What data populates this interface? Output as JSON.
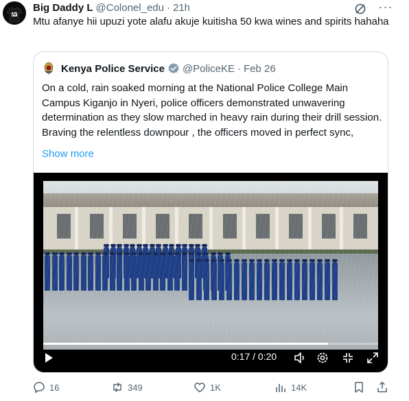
{
  "tweet": {
    "author_name": "Big Daddy L",
    "handle": "@Colonel_edu",
    "separator": "·",
    "time": "21h",
    "text": "Mtu afanye hii upuzi yote alafu akuje kuitisha 50 kwa wines and spirits hahaha",
    "more_icon": "···"
  },
  "quote": {
    "author_name": "Kenya Police Service",
    "handle": "@PoliceKE",
    "separator": "·",
    "date": "Feb 26",
    "text": "On a cold, rain soaked morning at the National Police College Main Campus Kiganjo in Nyeri, police officers demonstrated unwavering determination as they slow marched in heavy rain during their drill session. Braving the relentless downpour , the officers moved in perfect sync,",
    "show_more": "Show more",
    "verified_color": "#829aab"
  },
  "video": {
    "time_display": "0:17 / 0:20",
    "progress_fraction": 0.85,
    "controls": [
      "play-icon",
      "volume-icon",
      "settings-icon",
      "fullscreen-exit-icon",
      "expand-icon"
    ]
  },
  "actions": {
    "replies": "16",
    "reposts": "349",
    "likes": "1K",
    "views": "14K"
  },
  "colors": {
    "accent": "#1d9bf0",
    "secondary_text": "#536471",
    "border": "#cfd9de"
  }
}
